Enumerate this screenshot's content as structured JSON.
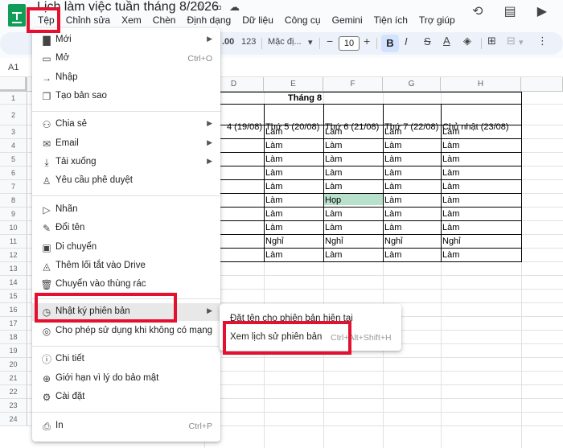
{
  "header": {
    "doc_title": "Lịch làm việc tuần tháng 8/2026",
    "menu": [
      "Tệp",
      "Chỉnh sửa",
      "Xem",
      "Chèn",
      "Định dạng",
      "Dữ liệu",
      "Công cụ",
      "Gemini",
      "Tiện ích",
      "Trợ giúp"
    ]
  },
  "toolbar": {
    "decimal_increase": ".00",
    "format_123": "123",
    "font_name": "Mặc đị...",
    "font_size": "10",
    "minus": "−",
    "plus": "+",
    "bold": "B",
    "italic": "I",
    "strike": "S",
    "text_color": "A"
  },
  "formula_bar": {
    "name_box": "A1"
  },
  "sheet": {
    "columns": [
      "D",
      "E",
      "F",
      "G",
      "H"
    ],
    "rows": [
      "1",
      "2",
      "3",
      "4",
      "5",
      "6",
      "7",
      "8",
      "9",
      "10",
      "11",
      "12",
      "13",
      "14",
      "15",
      "16",
      "17",
      "18",
      "19",
      "20",
      "21",
      "22",
      "23",
      "24"
    ],
    "month_title": "Tháng 8",
    "day_headers": [
      "4 (19/08)",
      "Thứ 5 (20/08)",
      "Thứ 6 (21/08)",
      "Thứ 7 (22/08)",
      "Chủ nhật (23/08)"
    ],
    "data_rows": [
      [
        "Làm",
        "Làm",
        "Làm",
        "Làm"
      ],
      [
        "Làm",
        "Làm",
        "Làm",
        "Làm"
      ],
      [
        "Làm",
        "Làm",
        "Làm",
        "Làm"
      ],
      [
        "Làm",
        "Làm",
        "Làm",
        "Làm"
      ],
      [
        "Làm",
        "Làm",
        "Làm",
        "Làm"
      ],
      [
        "Làm",
        "Họp",
        "Làm",
        "Làm"
      ],
      [
        "Làm",
        "Làm",
        "Làm",
        "Làm"
      ],
      [
        "Làm",
        "Làm",
        "Làm",
        "Làm"
      ],
      [
        "Nghỉ",
        "Nghỉ",
        "Nghỉ",
        "Nghỉ"
      ],
      [
        "Làm",
        "Làm",
        "Làm",
        "Làm"
      ]
    ],
    "highlight_color": "#b7e1cd"
  },
  "file_menu": {
    "items": [
      {
        "icon": "new-icon",
        "label": "Mới",
        "arrow": "▶"
      },
      {
        "icon": "open-icon",
        "label": "Mở",
        "shortcut": "Ctrl+O"
      },
      {
        "icon": "import-icon",
        "label": "Nhập"
      },
      {
        "icon": "copy-icon",
        "label": "Tạo bản sao"
      },
      {
        "icon": "share-icon",
        "label": "Chia sẻ",
        "arrow": "▶"
      },
      {
        "icon": "email-icon",
        "label": "Email",
        "arrow": "▶"
      },
      {
        "icon": "download-icon",
        "label": "Tải xuống",
        "arrow": "▶"
      },
      {
        "icon": "approval-icon",
        "label": "Yêu cầu phê duyệt"
      },
      {
        "icon": "label-icon",
        "label": "Nhãn"
      },
      {
        "icon": "rename-icon",
        "label": "Đổi tên"
      },
      {
        "icon": "move-icon",
        "label": "Di chuyển"
      },
      {
        "icon": "drive-shortcut-icon",
        "label": "Thêm lối tắt vào Drive"
      },
      {
        "icon": "trash-icon",
        "label": "Chuyển vào thùng rác"
      },
      {
        "icon": "history-icon",
        "label": "Nhật ký phiên bản",
        "arrow": "▶"
      },
      {
        "icon": "offline-icon",
        "label": "Cho phép sử dụng khi không có mạng"
      },
      {
        "icon": "info-icon",
        "label": "Chi tiết"
      },
      {
        "icon": "security-icon",
        "label": "Giới hạn vì lý do bảo mật"
      },
      {
        "icon": "settings-icon",
        "label": "Cài đặt"
      },
      {
        "icon": "print-icon",
        "label": "In",
        "shortcut": "Ctrl+P"
      }
    ]
  },
  "version_submenu": {
    "items": [
      {
        "label": "Đặt tên cho phiên bản hiện tại"
      },
      {
        "label": "Xem lịch sử phiên bản",
        "shortcut": "Ctrl+Alt+Shift+H"
      }
    ]
  },
  "colors": {
    "highlight_red": "#e3102f",
    "accent_green": "#0f9d58"
  }
}
